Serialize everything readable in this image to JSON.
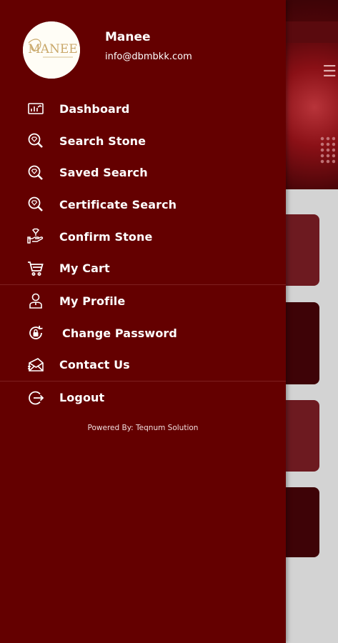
{
  "user": {
    "name": "Manee",
    "email": "info@dbmbkk.com",
    "avatar_text": "MANEE"
  },
  "menu": {
    "group1": [
      {
        "label": "Dashboard",
        "icon": "dashboard-icon"
      },
      {
        "label": "Search Stone",
        "icon": "search-diamond-icon"
      },
      {
        "label": "Saved Search",
        "icon": "search-diamond-icon"
      },
      {
        "label": "Certificate Search",
        "icon": "search-diamond-icon"
      },
      {
        "label": "Confirm Stone",
        "icon": "stone-hand-icon"
      },
      {
        "label": "My Cart",
        "icon": "cart-icon"
      }
    ],
    "group2": [
      {
        "label": "My Profile",
        "icon": "user-icon"
      },
      {
        "label": "Change Password",
        "icon": "lock-refresh-icon"
      },
      {
        "label": "Contact Us",
        "icon": "mail-icon"
      }
    ],
    "group3": [
      {
        "label": "Logout",
        "icon": "logout-icon"
      }
    ]
  },
  "footer": {
    "powered_by": "Powered By: Teqnum Solution"
  },
  "colors": {
    "drawer_bg": "#640000",
    "text": "#ffffff"
  }
}
